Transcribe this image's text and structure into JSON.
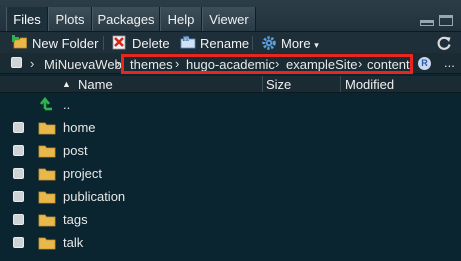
{
  "tabs": [
    {
      "label": "Files",
      "active": true
    },
    {
      "label": "Plots",
      "active": false
    },
    {
      "label": "Packages",
      "active": false
    },
    {
      "label": "Help",
      "active": false
    },
    {
      "label": "Viewer",
      "active": false
    }
  ],
  "toolbar": {
    "new_folder": "New Folder",
    "delete": "Delete",
    "rename": "Rename",
    "more": "More",
    "more_caret": "▾"
  },
  "breadcrumb": {
    "items": [
      "MiNuevaWeb",
      "themes",
      "hugo-academic",
      "exampleSite",
      "content"
    ],
    "separator": "›",
    "overflow": "..."
  },
  "columns": {
    "name": "Name",
    "sort_indicator": "▲",
    "size": "Size",
    "modified": "Modified"
  },
  "files": [
    {
      "name": "..",
      "icon": "up-arrow-icon"
    },
    {
      "name": "home",
      "icon": "folder-icon"
    },
    {
      "name": "post",
      "icon": "folder-icon"
    },
    {
      "name": "project",
      "icon": "folder-icon"
    },
    {
      "name": "publication",
      "icon": "folder-icon"
    },
    {
      "name": "tags",
      "icon": "folder-icon"
    },
    {
      "name": "talk",
      "icon": "folder-icon"
    }
  ],
  "colors": {
    "background": "#0b2530",
    "highlight": "#e8261d",
    "folder": "#e9b84a",
    "up_arrow": "#2fb24a"
  }
}
